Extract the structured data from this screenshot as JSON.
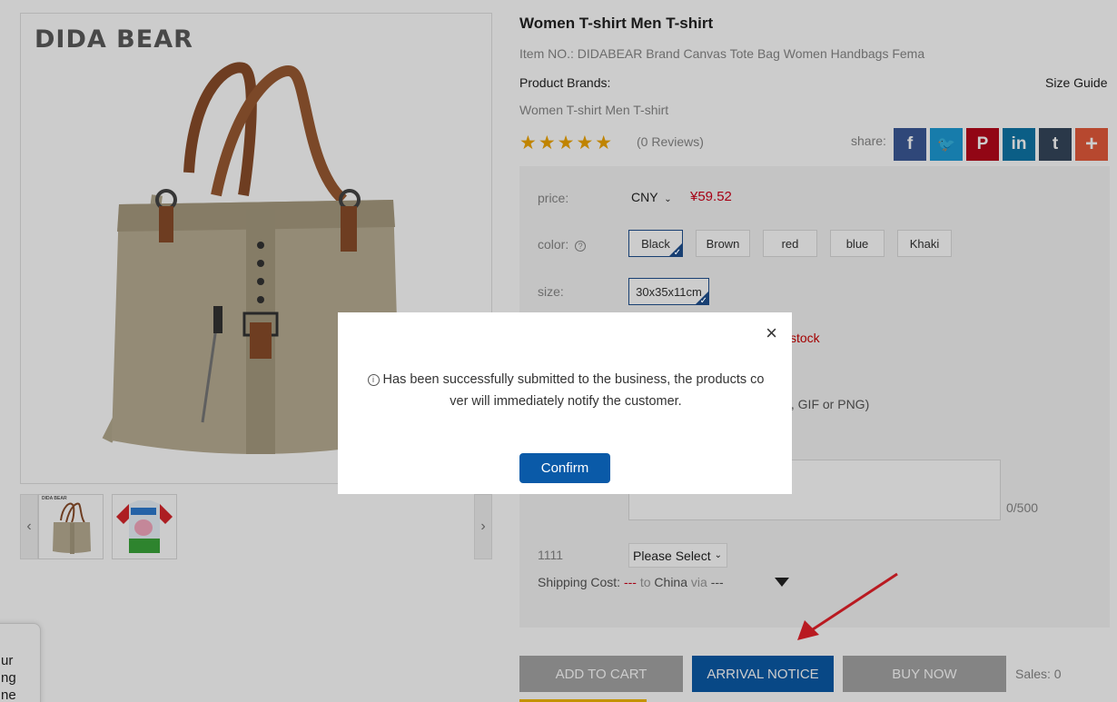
{
  "gallery": {
    "brand_logo": "DIDA BEAR",
    "thumb_logo": "DIDA BEAR",
    "prev_glyph": "‹",
    "next_glyph": "›"
  },
  "product": {
    "title": "Women T-shirt Men T-shirt",
    "item_no": "Item NO.: DIDABEAR Brand Canvas Tote Bag Women Handbags Fema",
    "brands_label": "Product Brands:",
    "size_guide": "Size Guide",
    "subtitle": "Women T-shirt Men T-shirt",
    "rating": 5,
    "stars": "★★★★★",
    "reviews": "(0 Reviews)",
    "share_label": "share:"
  },
  "share": [
    {
      "icon": "facebook-icon",
      "glyph": "f",
      "color": "#3b5998"
    },
    {
      "icon": "twitter-icon",
      "glyph": "🐦",
      "color": "#1d9bd6"
    },
    {
      "icon": "pinterest-icon",
      "glyph": "P",
      "color": "#b7081b"
    },
    {
      "icon": "linkedin-icon",
      "glyph": "in",
      "color": "#0e76a8"
    },
    {
      "icon": "tumblr-icon",
      "glyph": "t",
      "color": "#35465c"
    },
    {
      "icon": "plus-icon",
      "glyph": "+",
      "color": "#e55b3b"
    }
  ],
  "options": {
    "price_label": "price:",
    "currency": "CNY",
    "price": "¥59.52",
    "color_label": "color:",
    "colors": [
      "Black",
      "Brown",
      "red",
      "blue",
      "Khaki"
    ],
    "selected_color": "Black",
    "size_label": "size:",
    "size": "30x35x11cm",
    "stock_text": "stock",
    "format_text": "G, GIF or PNG)",
    "counter": "0/500",
    "attr_label": "1111",
    "attr_select": "Please Select",
    "shipping": {
      "label": "Shipping Cost:",
      "cost": "---",
      "to": "to",
      "country": "China",
      "via": "via",
      "method": "---"
    }
  },
  "actions": {
    "add_to_cart": "ADD TO CART",
    "arrival_notice": "ARRIVAL NOTICE",
    "buy_now": "BUY NOW",
    "sales": "Sales: 0"
  },
  "side_card": {
    "lines": [
      "ur",
      "ng",
      "ne"
    ]
  },
  "modal": {
    "close_glyph": "×",
    "info_glyph": "i",
    "message": "Has been successfully submitted to the business, the products co ver will immediately notify the customer.",
    "confirm": "Confirm"
  },
  "colors": {
    "accent_blue": "#0a5aa8",
    "price_red": "#d0021b",
    "star": "#f0a500",
    "annotation_arrow": "#e8212a"
  }
}
